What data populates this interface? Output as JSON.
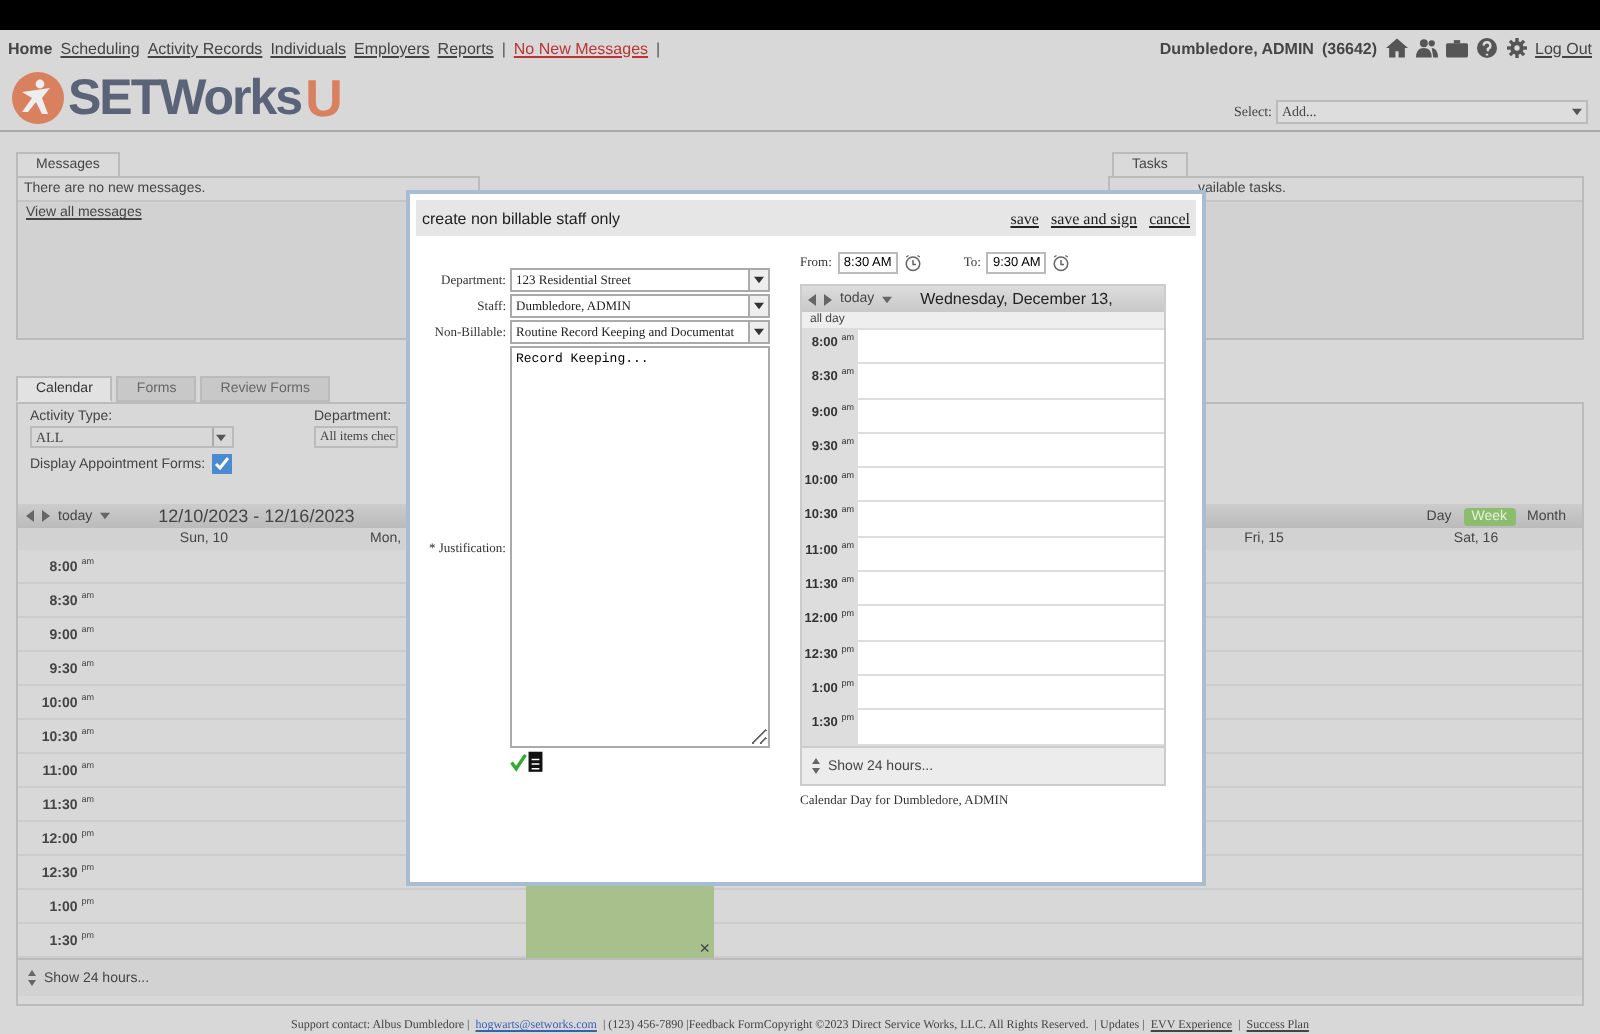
{
  "nav": {
    "links": [
      {
        "label": "Home",
        "selected": true
      },
      {
        "label": "Scheduling",
        "selected": false
      },
      {
        "label": "Activity Records",
        "selected": false
      },
      {
        "label": "Individuals",
        "selected": false
      },
      {
        "label": "Employers",
        "selected": false
      },
      {
        "label": "Reports",
        "selected": false
      }
    ],
    "separator": "|",
    "messages_link": "No New Messages",
    "user": "Dumbledore, ADMIN",
    "user_id": "(36642)",
    "logout": "Log Out"
  },
  "logo": {
    "text": "SETWorks",
    "suffix": "U"
  },
  "select": {
    "label": "Select:",
    "value": "Add..."
  },
  "messages": {
    "tab": "Messages",
    "text": "There are no new messages.",
    "link": "View all messages"
  },
  "tasks": {
    "tab": "Tasks",
    "text": "vailable tasks."
  },
  "tabs": [
    {
      "label": "Calendar",
      "selected": true
    },
    {
      "label": "Forms",
      "selected": false
    },
    {
      "label": "Review Forms",
      "selected": false
    }
  ],
  "filters": {
    "activity_label": "Activity Type:",
    "activity_value": "ALL",
    "department_label": "Department:",
    "department_value": "All items chec",
    "display_forms": {
      "label": "Display Appointment Forms:",
      "checked": true
    }
  },
  "week_calendar": {
    "today": "today",
    "range": "12/10/2023 - 12/16/2023",
    "views": [
      {
        "label": "Day",
        "selected": false
      },
      {
        "label": "Week",
        "selected": true
      },
      {
        "label": "Month",
        "selected": false
      }
    ],
    "days_left": [
      "Sun, 10",
      "Mon,"
    ],
    "days_right": [
      "Fri, 15",
      "Sat, 16"
    ],
    "times": [
      {
        "time": "8:00",
        "suffix": "am"
      },
      {
        "time": "8:30",
        "suffix": "am"
      },
      {
        "time": "9:00",
        "suffix": "am"
      },
      {
        "time": "9:30",
        "suffix": "am"
      },
      {
        "time": "10:00",
        "suffix": "am"
      },
      {
        "time": "10:30",
        "suffix": "am"
      },
      {
        "time": "11:00",
        "suffix": "am"
      },
      {
        "time": "11:30",
        "suffix": "am"
      },
      {
        "time": "12:00",
        "suffix": "pm"
      },
      {
        "time": "12:30",
        "suffix": "pm"
      },
      {
        "time": "1:00",
        "suffix": "pm"
      },
      {
        "time": "1:30",
        "suffix": "pm"
      }
    ],
    "event_close": "×",
    "show_hours": "Show 24 hours..."
  },
  "footer": {
    "text": "Support contact: Albus Dumbledore |",
    "email": "hogwarts@setworks.com",
    "text2": "| (123) 456-7890 |Feedback FormCopyright ©2023 Direct Service Works, LLC. All Rights Reserved.",
    "updates": "| Updates |",
    "evv": "EVV Experience",
    "sep": "|",
    "success": "Success Plan"
  },
  "dialog": {
    "title": "create non billable staff only",
    "actions": [
      "save",
      "save and sign",
      "cancel"
    ],
    "fields": [
      {
        "label": "Department:",
        "value": "123 Residential Street"
      },
      {
        "label": "Staff:",
        "value": "Dumbledore, ADMIN"
      },
      {
        "label": "Non-Billable:",
        "value": "Routine Record Keeping and Documentat"
      }
    ],
    "justification_label": "* Justification:",
    "justification": "Record Keeping...",
    "from_label": "From:",
    "from": "8:30 AM",
    "to_label": "To:",
    "to": "9:30 AM",
    "day_calendar": {
      "today": "today",
      "title": "Wednesday, December 13,",
      "all_day": "all day",
      "times": [
        {
          "time": "8:00",
          "suffix": "am"
        },
        {
          "time": "8:30",
          "suffix": "am"
        },
        {
          "time": "9:00",
          "suffix": "am"
        },
        {
          "time": "9:30",
          "suffix": "am"
        },
        {
          "time": "10:00",
          "suffix": "am"
        },
        {
          "time": "10:30",
          "suffix": "am"
        },
        {
          "time": "11:00",
          "suffix": "am"
        },
        {
          "time": "11:30",
          "suffix": "am"
        },
        {
          "time": "12:00",
          "suffix": "pm"
        },
        {
          "time": "12:30",
          "suffix": "pm"
        },
        {
          "time": "1:00",
          "suffix": "pm"
        },
        {
          "time": "1:30",
          "suffix": "pm"
        }
      ],
      "show_hours": "Show 24 hours...",
      "caption": "Calendar Day for Dumbledore, ADMIN"
    }
  }
}
